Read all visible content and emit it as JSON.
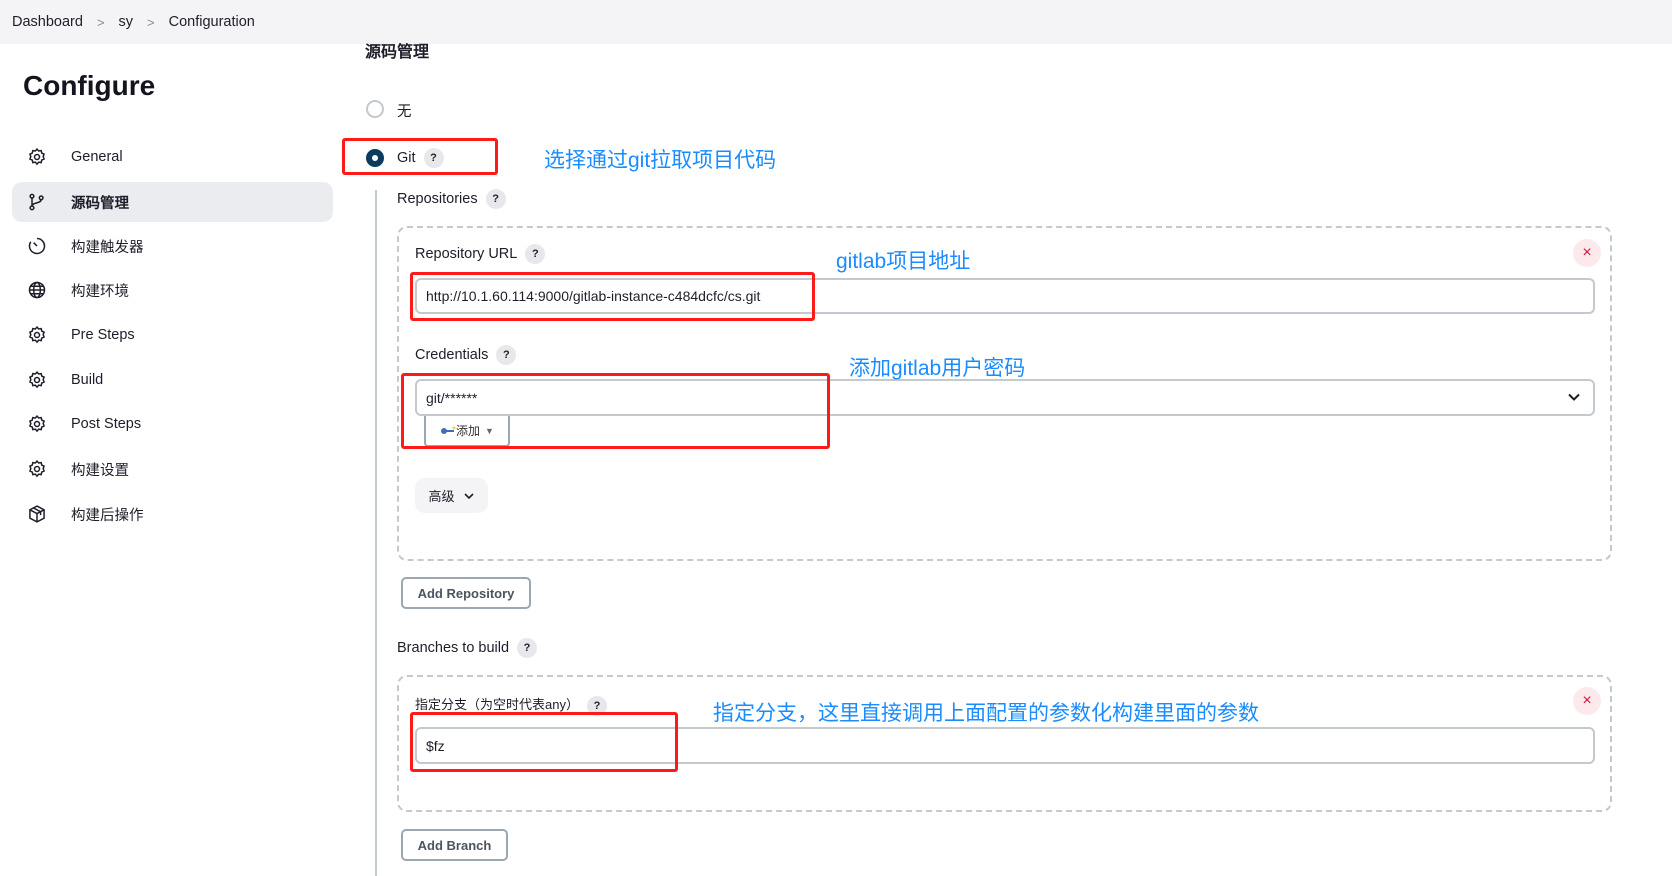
{
  "breadcrumb": {
    "items": [
      "Dashboard",
      "sy",
      "Configuration"
    ],
    "separator": ">"
  },
  "page_title": "Configure",
  "sidebar": {
    "items": [
      {
        "label": "General",
        "icon": "gear-icon",
        "active": false
      },
      {
        "label": "源码管理",
        "icon": "git-branch-icon",
        "active": true
      },
      {
        "label": "构建触发器",
        "icon": "timer-icon",
        "active": false
      },
      {
        "label": "构建环境",
        "icon": "globe-icon",
        "active": false
      },
      {
        "label": "Pre Steps",
        "icon": "gear-icon",
        "active": false
      },
      {
        "label": "Build",
        "icon": "gear-icon",
        "active": false
      },
      {
        "label": "Post Steps",
        "icon": "gear-icon",
        "active": false
      },
      {
        "label": "构建设置",
        "icon": "gear-icon",
        "active": false
      },
      {
        "label": "构建后操作",
        "icon": "package-icon",
        "active": false
      }
    ]
  },
  "scm": {
    "section_title": "源码管理",
    "options": [
      {
        "label": "无",
        "selected": false
      },
      {
        "label": "Git",
        "selected": true
      }
    ],
    "help_label": "?",
    "repositories_label": "Repositories",
    "repository_url_label": "Repository URL",
    "repository_url_value": "http://10.1.60.114:9000/gitlab-instance-c484dcfc/cs.git",
    "credentials_label": "Credentials",
    "credentials_value": "git/******",
    "add_credentials_label": "添加",
    "advanced_label": "高级",
    "add_repository_label": "Add Repository",
    "branches_label": "Branches to build",
    "branch_specifier_label": "指定分支（为空时代表any）",
    "branch_specifier_value": "$fz",
    "add_branch_label": "Add Branch",
    "remove_label": "×"
  },
  "annotations": {
    "git": "选择通过git拉取项目代码",
    "repo_url": "gitlab项目地址",
    "credentials": "添加gitlab用户密码",
    "branch": "指定分支，这里直接调用上面配置的参数化构建里面的参数",
    "color": "#1a8cff",
    "highlight_color": "#ff1a1a"
  }
}
